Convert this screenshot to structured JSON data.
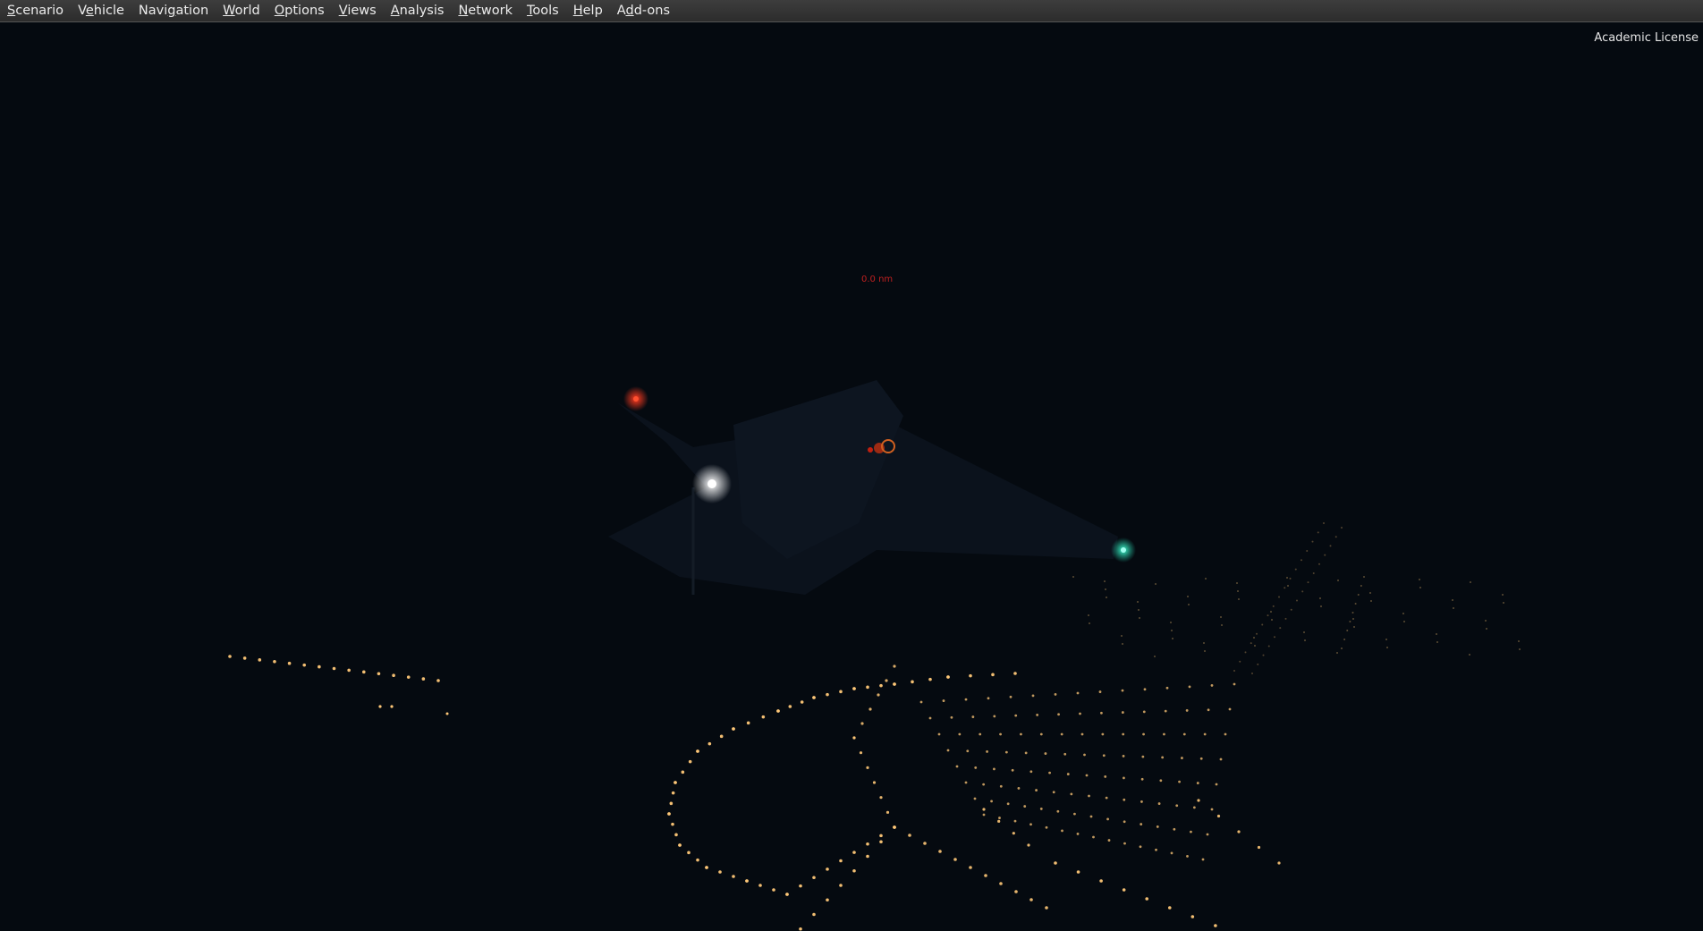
{
  "menubar": {
    "items": [
      {
        "name": "scenario",
        "u": "S",
        "rest": "cenario",
        "pre": ""
      },
      {
        "name": "vehicle",
        "pre": "V",
        "u": "e",
        "rest": "hicle"
      },
      {
        "name": "navigation",
        "pre": "Navi",
        "u": "g",
        "rest": "ation"
      },
      {
        "name": "world",
        "pre": "",
        "u": "W",
        "rest": "orld"
      },
      {
        "name": "options",
        "pre": "",
        "u": "O",
        "rest": "ptions"
      },
      {
        "name": "views",
        "pre": "",
        "u": "V",
        "rest": "iews"
      },
      {
        "name": "analysis",
        "pre": "",
        "u": "A",
        "rest": "nalysis"
      },
      {
        "name": "network",
        "pre": "",
        "u": "N",
        "rest": "etwork"
      },
      {
        "name": "tools",
        "pre": "",
        "u": "T",
        "rest": "ools"
      },
      {
        "name": "help",
        "pre": "",
        "u": "H",
        "rest": "elp"
      },
      {
        "name": "add-ons",
        "pre": "A",
        "u": "d",
        "rest": "d-ons"
      }
    ]
  },
  "overlay": {
    "license": "Academic License",
    "range_readout": "0.0 nm"
  },
  "scene": {
    "sky_color": "#050a10",
    "light_color": "#ffb060",
    "nav_light_left": "#ff2a1a",
    "nav_light_right": "#20e0c0",
    "landing_light": "#ffffff"
  }
}
